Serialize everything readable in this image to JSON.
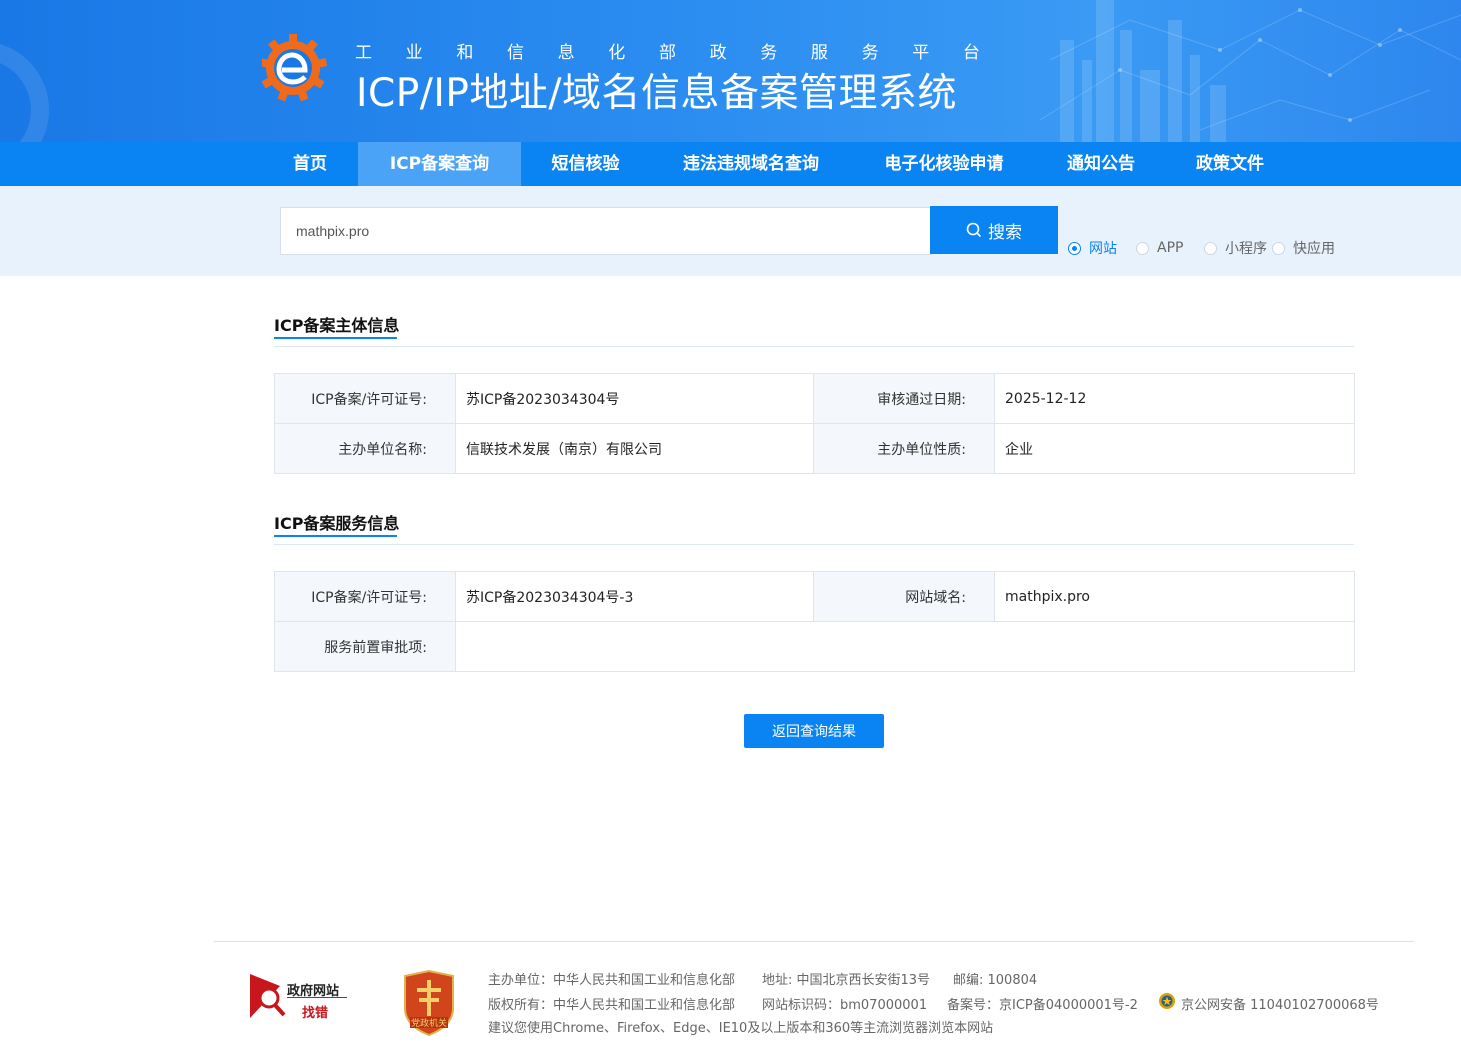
{
  "header": {
    "slogan": [
      "工",
      "业",
      "和",
      "信",
      "息",
      "化",
      "部",
      "政",
      "务",
      "服",
      "务",
      "平",
      "台"
    ],
    "system_title": "ICP/IP地址/域名信息备案管理系统"
  },
  "nav": {
    "items": [
      {
        "label": "首页",
        "active": false
      },
      {
        "label": "ICP备案查询",
        "active": true
      },
      {
        "label": "短信核验",
        "active": false
      },
      {
        "label": "违法违规域名查询",
        "active": false
      },
      {
        "label": "电子化核验申请",
        "active": false
      },
      {
        "label": "通知公告",
        "active": false
      },
      {
        "label": "政策文件",
        "active": false
      }
    ]
  },
  "search": {
    "value": "mathpix.pro",
    "button_label": "搜索",
    "types": [
      {
        "label": "网站",
        "checked": true
      },
      {
        "label": "APP",
        "checked": false
      },
      {
        "label": "小程序",
        "checked": false
      },
      {
        "label": "快应用",
        "checked": false
      }
    ]
  },
  "subject_info": {
    "title": "ICP备案主体信息",
    "license_label": "ICP备案/许可证号:",
    "license_value": "苏ICP备2023034304号",
    "approve_date_label": "审核通过日期:",
    "approve_date_value": "2025-12-12",
    "org_name_label": "主办单位名称:",
    "org_name_value": "信联技术发展（南京）有限公司",
    "org_type_label": "主办单位性质:",
    "org_type_value": "企业"
  },
  "service_info": {
    "title": "ICP备案服务信息",
    "license_label": "ICP备案/许可证号:",
    "license_value": "苏ICP备2023034304号-3",
    "domain_label": "网站域名:",
    "domain_value": "mathpix.pro",
    "pre_approval_label": "服务前置审批项:",
    "pre_approval_value": ""
  },
  "back_button_label": "返回查询结果",
  "footer": {
    "gov_site_text": "政府网站",
    "gov_error_text": "找错",
    "party_badge_text": "党政机关",
    "host": "主办单位：中华人民共和国工业和信息化部",
    "address": "地址: 中国北京西长安街13号",
    "postcode": "邮编: 100804",
    "copyright": "版权所有：中华人民共和国工业和信息化部",
    "site_id": "网站标识码：bm07000001",
    "icp": "备案号：京ICP备04000001号-2",
    "police": "京公网安备 11040102700068号",
    "browser_tip": "建议您使用Chrome、Firefox、Edge、IE10及以上版本和360等主流浏览器浏览本网站"
  },
  "colors": {
    "primary": "#0a84f2",
    "nav_active": "#4aa3f6",
    "search_band": "#e8f2fd",
    "label_bg": "#f4f8fc",
    "logo_orange": "#f06a1c",
    "gov_red": "#c8161d"
  }
}
